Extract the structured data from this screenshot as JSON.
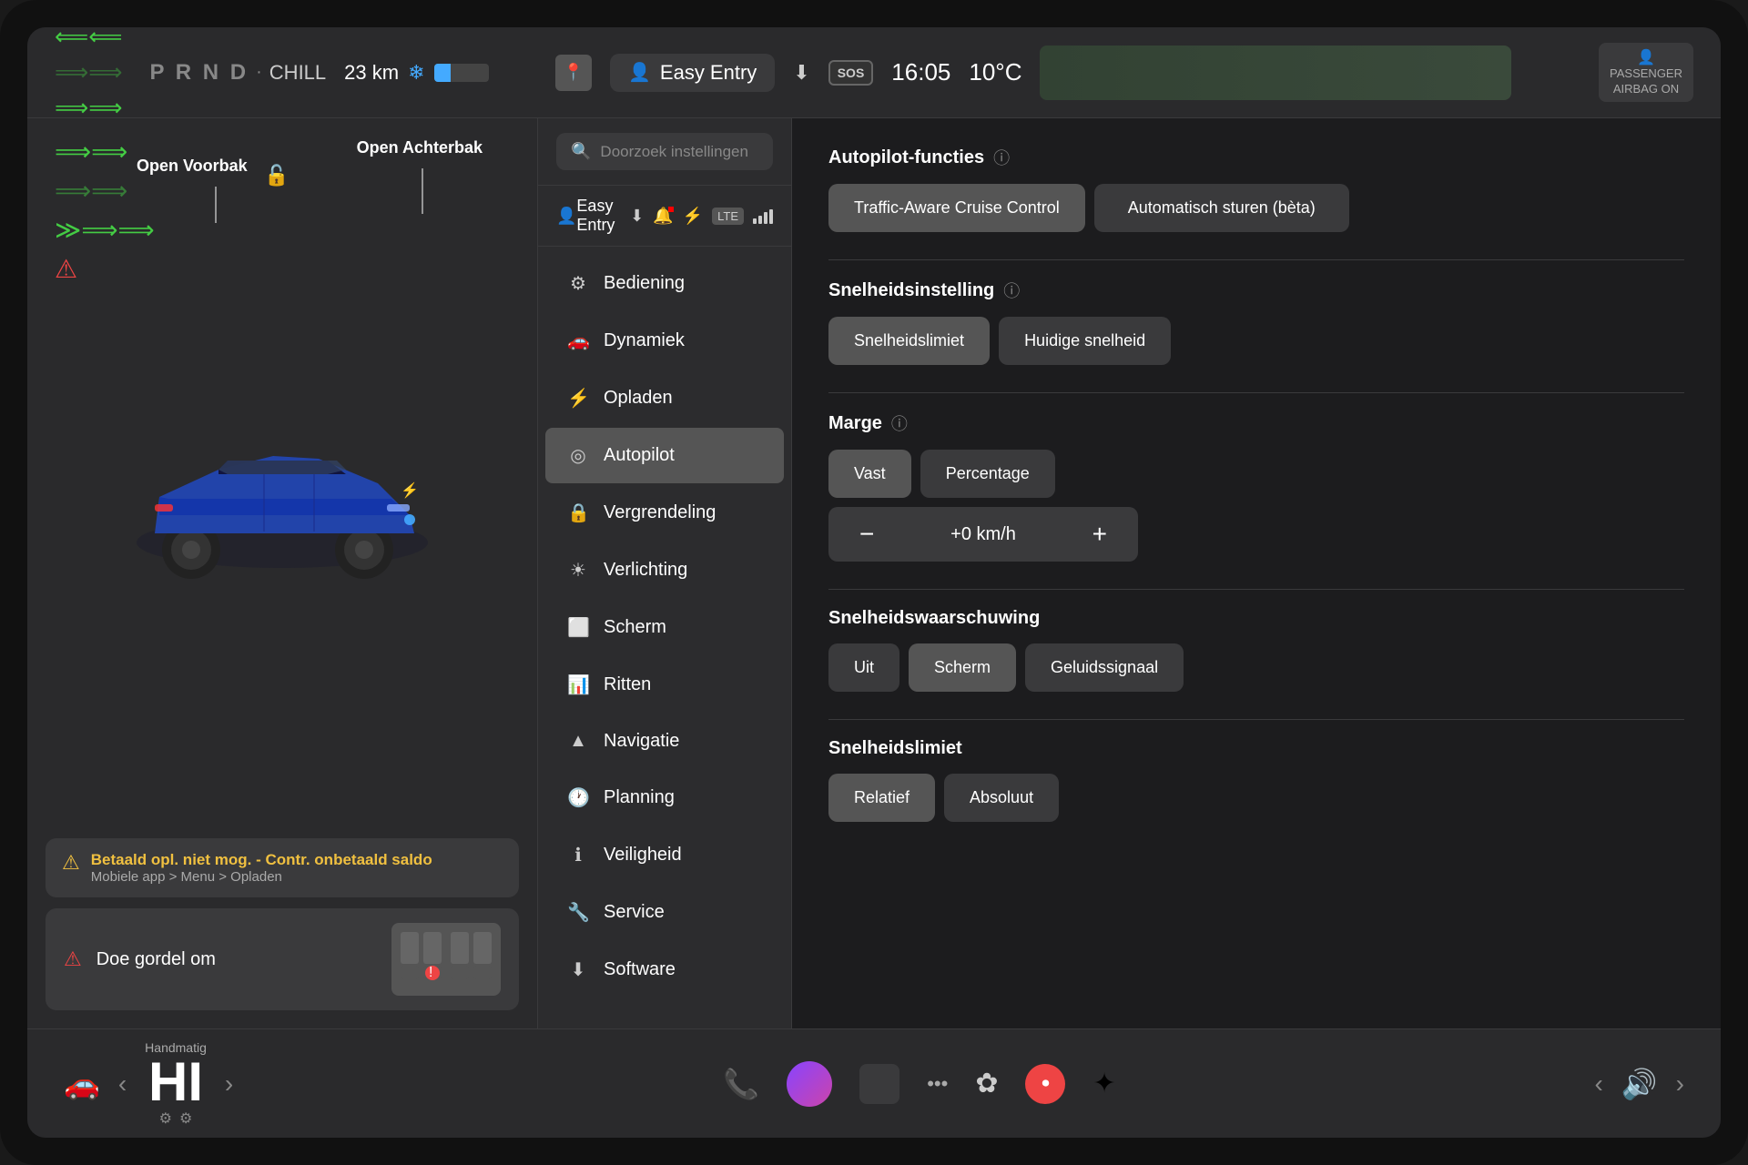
{
  "screen": {
    "bezel_bg": "#111",
    "content_bg": "#1c1c1e"
  },
  "top_bar": {
    "prnd": "P R N D",
    "drive_mode": "CHILL",
    "km": "23 km",
    "time": "16:05",
    "temp": "10°C",
    "easy_entry": "Easy Entry",
    "passenger_airbag_line1": "PASSENGER",
    "passenger_airbag_line2": "AIRBAG ON"
  },
  "search": {
    "placeholder": "Doorzoek instellingen"
  },
  "profile": {
    "label": "Easy Entry"
  },
  "nav_menu": {
    "items": [
      {
        "id": "bediening",
        "icon": "⚙",
        "label": "Bediening",
        "active": false
      },
      {
        "id": "dynamiek",
        "icon": "🚗",
        "label": "Dynamiek",
        "active": false
      },
      {
        "id": "opladen",
        "icon": "⚡",
        "label": "Opladen",
        "active": false
      },
      {
        "id": "autopilot",
        "icon": "◎",
        "label": "Autopilot",
        "active": true
      },
      {
        "id": "vergrendeling",
        "icon": "🔒",
        "label": "Vergrendeling",
        "active": false
      },
      {
        "id": "verlichting",
        "icon": "☀",
        "label": "Verlichting",
        "active": false
      },
      {
        "id": "scherm",
        "icon": "⬜",
        "label": "Scherm",
        "active": false
      },
      {
        "id": "ritten",
        "icon": "📊",
        "label": "Ritten",
        "active": false
      },
      {
        "id": "navigatie",
        "icon": "▲",
        "label": "Navigatie",
        "active": false
      },
      {
        "id": "planning",
        "icon": "🕐",
        "label": "Planning",
        "active": false
      },
      {
        "id": "veiligheid",
        "icon": "ℹ",
        "label": "Veiligheid",
        "active": false
      },
      {
        "id": "service",
        "icon": "🔧",
        "label": "Service",
        "active": false
      },
      {
        "id": "software",
        "icon": "⬇",
        "label": "Software",
        "active": false
      }
    ]
  },
  "autopilot": {
    "section_autopilot_functies": {
      "title": "Autopilot-functies",
      "btn1": "Traffic-Aware Cruise Control",
      "btn2": "Automatisch sturen (bèta)"
    },
    "section_snelheidsinstelling": {
      "title": "Snelheidsinstelling",
      "btn1": "Snelheidslimiet",
      "btn2": "Huidige snelheid"
    },
    "section_marge": {
      "title": "Marge",
      "btn1": "Vast",
      "btn2": "Percentage",
      "speed_value": "+0 km/h",
      "speed_minus": "−",
      "speed_plus": "+"
    },
    "section_snelheidswaarschuwing": {
      "title": "Snelheidswaarschuwing",
      "btn1": "Uit",
      "btn2": "Scherm",
      "btn3": "Geluidssignaal"
    },
    "section_snelheidslimiet": {
      "title": "Snelheidslimiet",
      "btn1": "Relatief",
      "btn2": "Absoluut"
    }
  },
  "left_panel": {
    "open_voorbak": "Open\nVoorbak",
    "open_achterbak": "Open\nAchterbak",
    "alert_main": "Betaald opl. niet mog. - Contr. onbetaald saldo",
    "alert_sub": "Mobiele app > Menu > Opladen",
    "seatbelt_text": "Doe gordel om",
    "gear_label": "Handmatig",
    "gear_value": "HI",
    "gear_sub": "⚙"
  },
  "bottom_bar": {
    "car_icon": "🚗",
    "phone_icon": "📞",
    "nav_prev": "‹",
    "nav_next": "›",
    "vol_down": "◄",
    "vol_label": "🔊",
    "vol_up": "►"
  }
}
